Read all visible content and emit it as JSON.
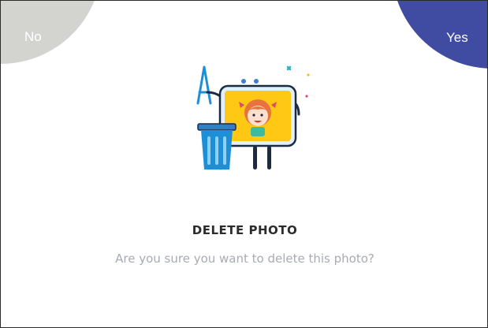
{
  "dialog": {
    "no_label": "No",
    "yes_label": "Yes",
    "title": "DELETE PHOTO",
    "message": "Are you sure you want to delete this photo?"
  },
  "colors": {
    "no_button": "#d3d3d0",
    "yes_button": "#3f4ca1",
    "photo_frame": "#ffc814",
    "trash_can": "#1e8fd6",
    "title_text": "#2b2b2b",
    "message_text": "#a7abb3"
  },
  "icons": {
    "illustration": "photo-frame-with-trash-icon"
  }
}
